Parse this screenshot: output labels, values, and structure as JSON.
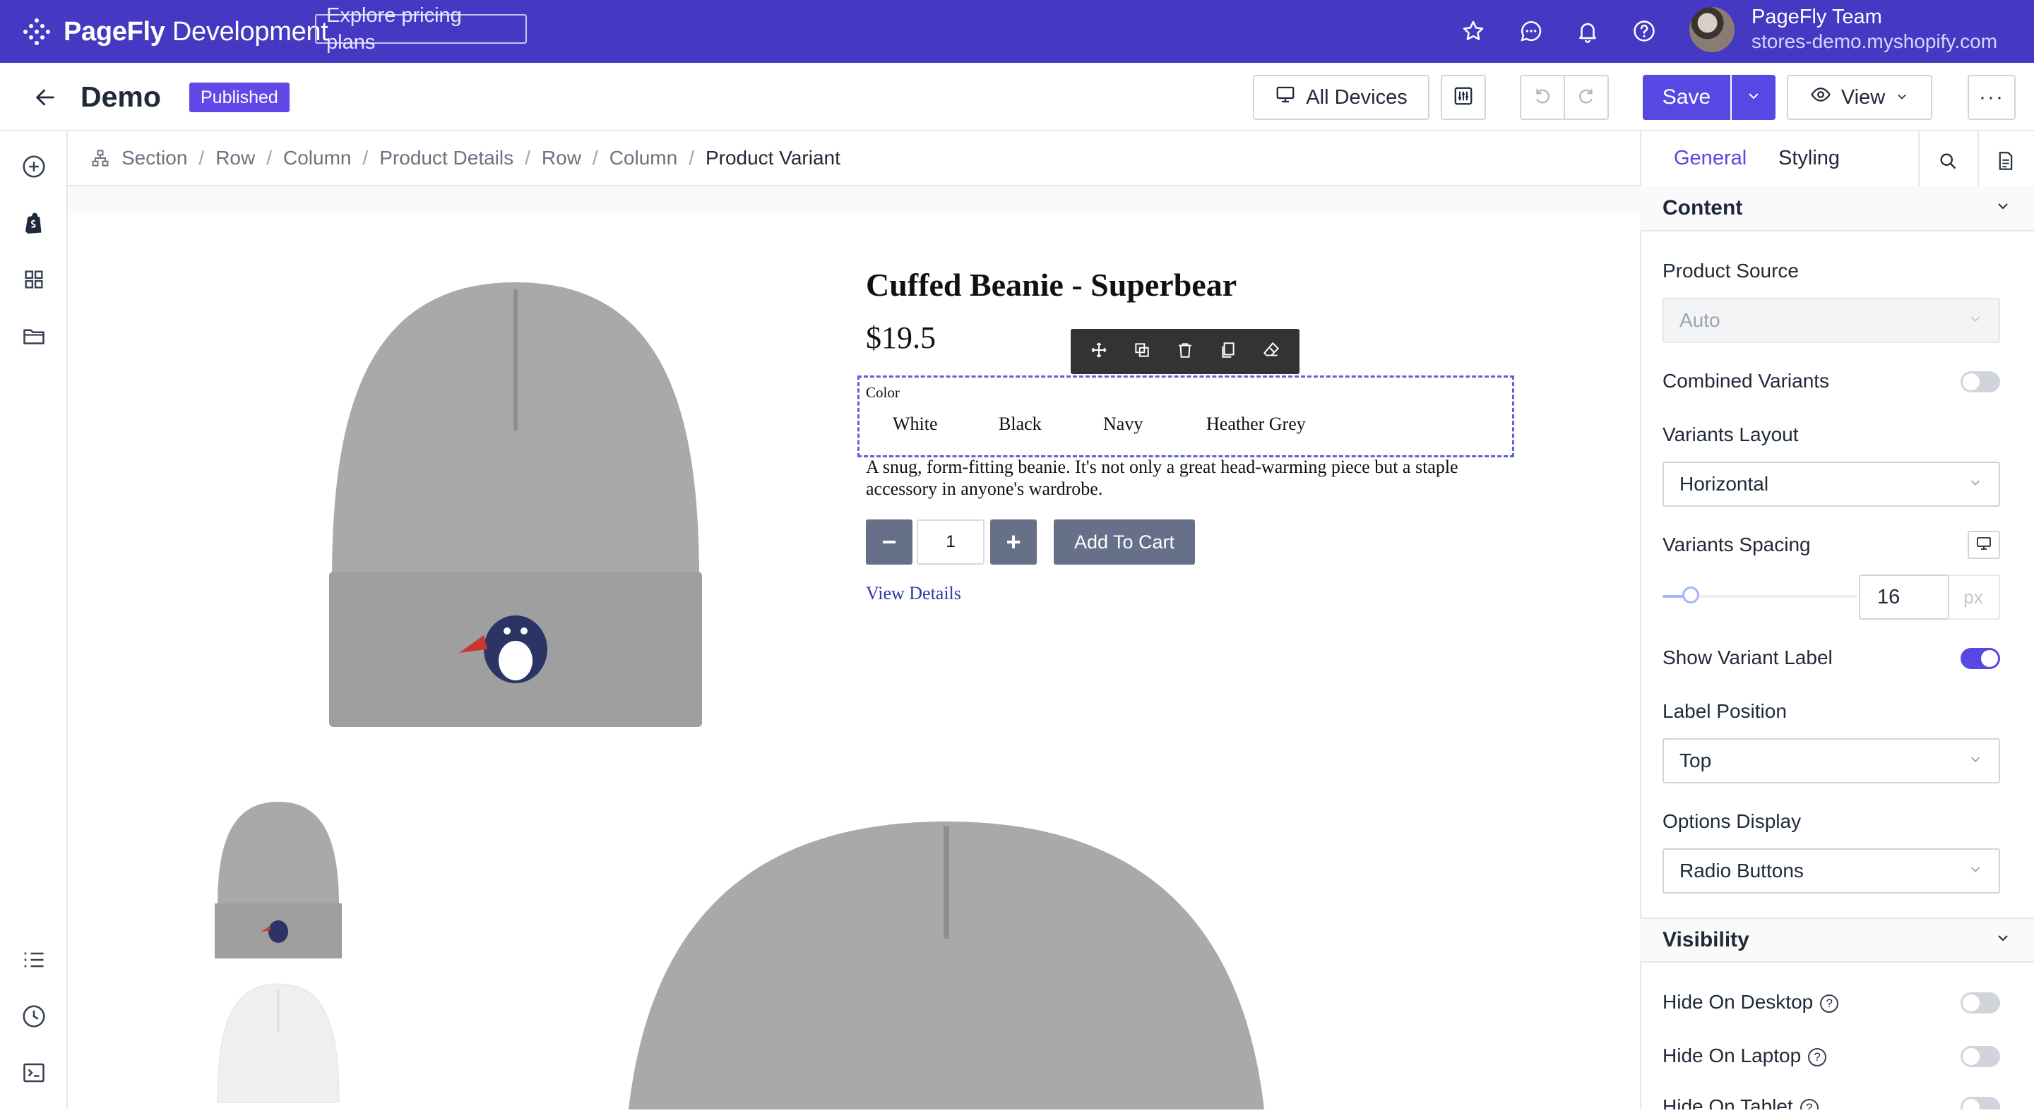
{
  "topbar": {
    "brand_bold": "PageFly",
    "brand_light": " Development",
    "explore_label": "Explore pricing plans",
    "icons": [
      "star-icon",
      "chat-icon",
      "bell-icon",
      "help-icon"
    ],
    "team_name": "PageFly Team",
    "store_url": "stores-demo.myshopify.com"
  },
  "secondbar": {
    "page_title": "Demo",
    "status": "Published",
    "devices_label": "All Devices",
    "save_label": "Save",
    "view_label": "View",
    "more_label": "···"
  },
  "leftrail": {
    "icons": [
      "add-element-icon",
      "shopify-icon",
      "grid-icon",
      "folder-icon",
      "layers-list-icon",
      "history-icon",
      "console-icon"
    ]
  },
  "breadcrumb": [
    "Section",
    "Row",
    "Column",
    "Product Details",
    "Row",
    "Column",
    "Product Variant"
  ],
  "product": {
    "title": "Cuffed Beanie - Superbear",
    "price": "$19.5",
    "variant_label": "Color",
    "variants": [
      "White",
      "Black",
      "Navy",
      "Heather Grey"
    ],
    "description": "A snug, form-fitting beanie. It's not only a great head-warming piece but a staple accessory in anyone's wardrobe.",
    "quantity": "1",
    "qty_minus": "−",
    "qty_plus": "+",
    "add_to_cart": "Add To Cart",
    "view_details": "View Details",
    "colors": {
      "beanie": "#a9a9a9",
      "beanie_white": "#f0f0f0"
    }
  },
  "panel": {
    "tabs": [
      "General",
      "Styling"
    ],
    "content_header": "Content",
    "product_source_label": "Product Source",
    "product_source_value": "Auto",
    "combined_variants_label": "Combined Variants",
    "combined_variants_on": false,
    "variants_layout_label": "Variants Layout",
    "variants_layout_value": "Horizontal",
    "variants_spacing_label": "Variants Spacing",
    "variants_spacing_value": "16",
    "variants_spacing_unit": "px",
    "show_variant_label_label": "Show Variant Label",
    "show_variant_label_on": true,
    "label_position_label": "Label Position",
    "label_position_value": "Top",
    "options_display_label": "Options Display",
    "options_display_value": "Radio Buttons",
    "visibility_header": "Visibility",
    "hide_desktop_label": "Hide On Desktop",
    "hide_laptop_label": "Hide On Laptop",
    "hide_tablet_label": "Hide On Tablet"
  },
  "colors": {
    "brand": "#4538c2",
    "accent": "#5747e3",
    "badge": "#6049e6",
    "product_button": "#667189",
    "selection_outline": "#5b61d6"
  }
}
